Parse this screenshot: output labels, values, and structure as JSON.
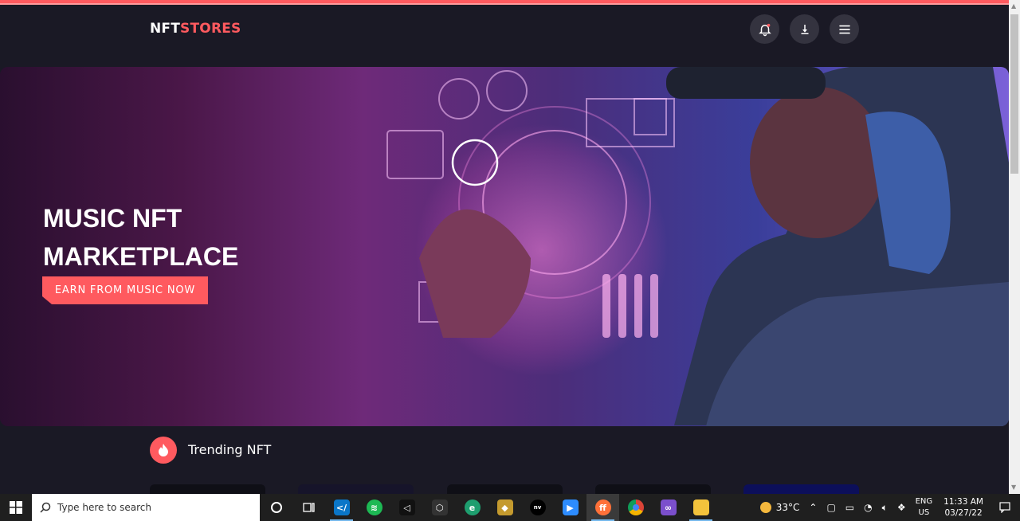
{
  "brand": {
    "part1": "NFT",
    "part2": "STORES"
  },
  "header": {
    "notification_icon": "bell-icon",
    "download_icon": "download-icon",
    "menu_icon": "hamburger-menu-icon"
  },
  "hero": {
    "title_line1": "MUSIC NFT",
    "title_line2": "MARKETPLACE",
    "cta_label": "EARN FROM MUSIC NOW"
  },
  "trending": {
    "title": "Trending NFT",
    "icon": "flame-icon"
  },
  "colors": {
    "accent": "#ff5a5f",
    "background": "#1a1925",
    "header_button": "#34333f"
  },
  "taskbar": {
    "search_placeholder": "Type here to search",
    "weather_temp": "33°C",
    "language": "ENG",
    "region": "US",
    "time": "11:33 AM",
    "date": "03/27/22",
    "apps": [
      "cortana",
      "task-view",
      "vscode",
      "spotify",
      "unity",
      "3d-viewer",
      "edge",
      "app",
      "nvidia",
      "zoom",
      "firefox",
      "chrome",
      "visual-studio",
      "file-explorer"
    ]
  }
}
